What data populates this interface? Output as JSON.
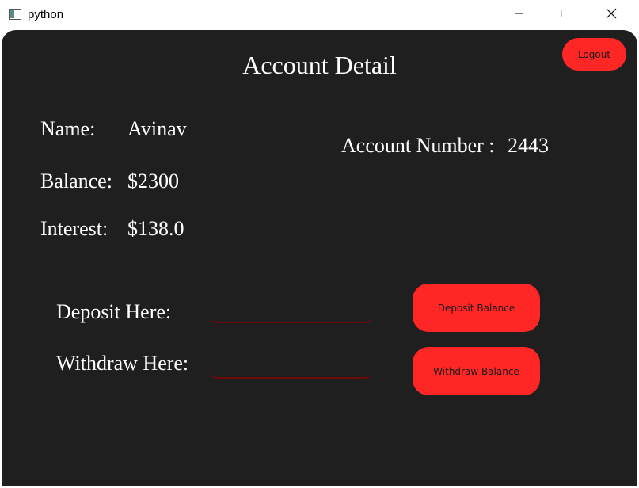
{
  "window": {
    "title": "python",
    "icon": "app-window-icon"
  },
  "colors": {
    "background": "#1f1f20",
    "accent": "#ff2626",
    "text": "#ffffff",
    "input_underline": "#6e0a0a"
  },
  "header": {
    "title": "Account Detail",
    "logout_label": "Logout"
  },
  "account": {
    "name_label": "Name:",
    "name_value": "Avinav",
    "balance_label": "Balance:",
    "balance_value": "$2300",
    "interest_label": "Interest:",
    "interest_value": "$138.0",
    "account_number_label": "Account Number :",
    "account_number_value": "2443"
  },
  "transactions": {
    "deposit_label": "Deposit Here:",
    "deposit_value": "",
    "deposit_button": "Deposit Balance",
    "withdraw_label": "Withdraw Here:",
    "withdraw_value": "",
    "withdraw_button": "Withdraw Balance"
  }
}
